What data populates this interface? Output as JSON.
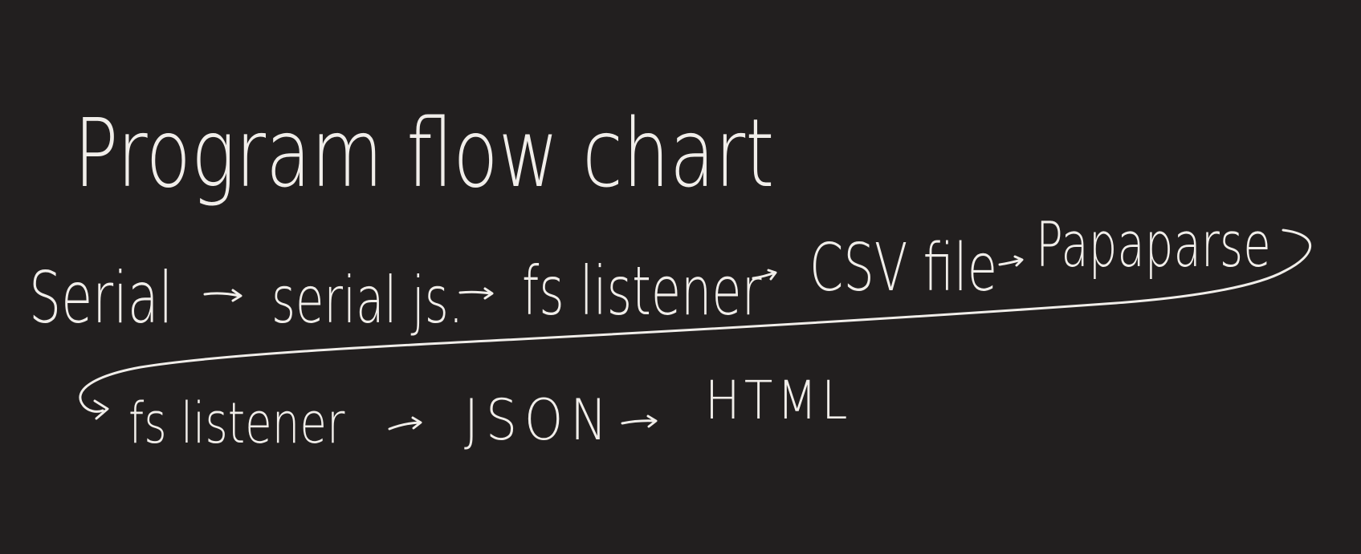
{
  "title": "Program flow chart",
  "flow_row_1": [
    "Serial",
    "serial js.",
    "fs listener",
    "CSV file",
    "Papaparse"
  ],
  "flow_row_2": [
    "fs listener",
    "JSON",
    "HTML"
  ],
  "colors": {
    "background": "#221f1f",
    "ink": "#f1eeea"
  }
}
